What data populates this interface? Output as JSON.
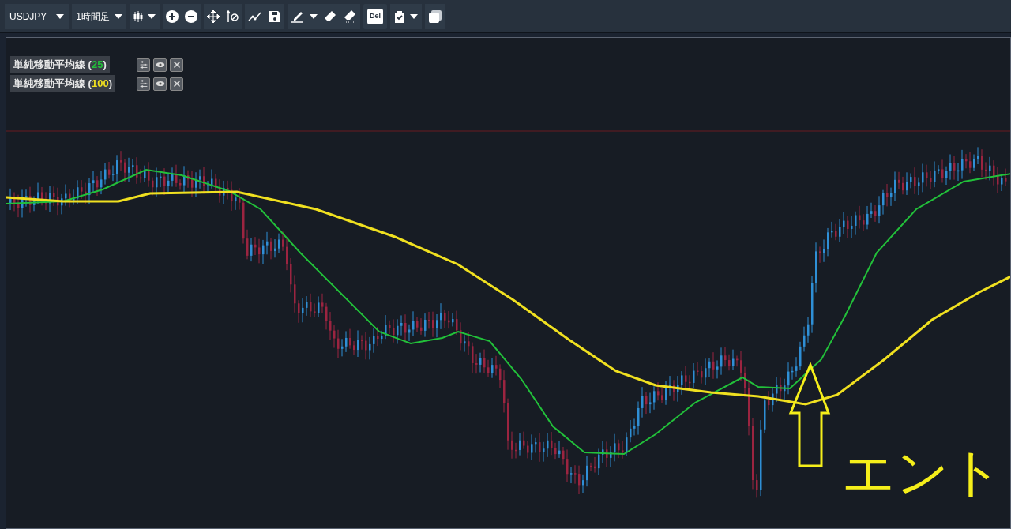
{
  "toolbar": {
    "symbol": "USDJPY",
    "timeframe": "1時間足",
    "delete_label": "Del"
  },
  "legend": [
    {
      "name": "単純移動平均線 (",
      "period": "25",
      "suffix": ")",
      "color": "#22c03a"
    },
    {
      "name": "単純移動平均線 (",
      "period": "100",
      "suffix": ")",
      "color": "#f0e020"
    }
  ],
  "overlay_text": "エント"
}
